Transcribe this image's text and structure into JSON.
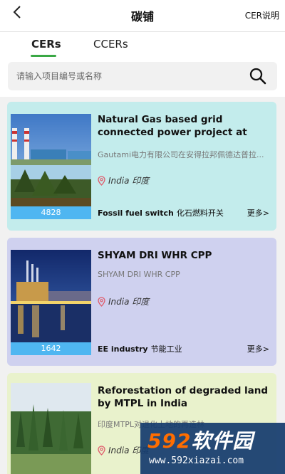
{
  "header": {
    "title": "碳铺",
    "cer_link": "CER说明"
  },
  "tabs": [
    {
      "label": "CERs"
    },
    {
      "label": "CCERs"
    }
  ],
  "search": {
    "placeholder": "请输入项目编号或名称"
  },
  "projects": [
    {
      "title": "Natural Gas based grid connected power project at Peddapuram, A.P. by ...",
      "subtitle": "Gautami电力有限公司在安得拉邦佩德达普拉...",
      "location": "India 印度",
      "count": "4828",
      "sector_en": "Fossil fuel switch",
      "sector_cn": "化石燃料开关",
      "more": "更多>"
    },
    {
      "title": "SHYAM DRI WHR CPP",
      "subtitle": "SHYAM DRI WHR CPP",
      "location": "India 印度",
      "count": "1642",
      "sector_en": "EE industry",
      "sector_cn": "节能工业",
      "more": "更多>"
    },
    {
      "title": "Reforestation of degraded land by MTPL in India",
      "subtitle": "印度MTPL对退化土地的再造林",
      "location": "India 印度"
    }
  ],
  "watermark": {
    "brand_num": "592",
    "brand_text": "软件园",
    "url": "www.592xiazai.com"
  },
  "colors": {
    "accent": "#3aa845",
    "count_bar": "#4fb6f1",
    "card1": "#c3ecec",
    "card2": "#cfd1ef",
    "card3": "#e9f2cc"
  }
}
